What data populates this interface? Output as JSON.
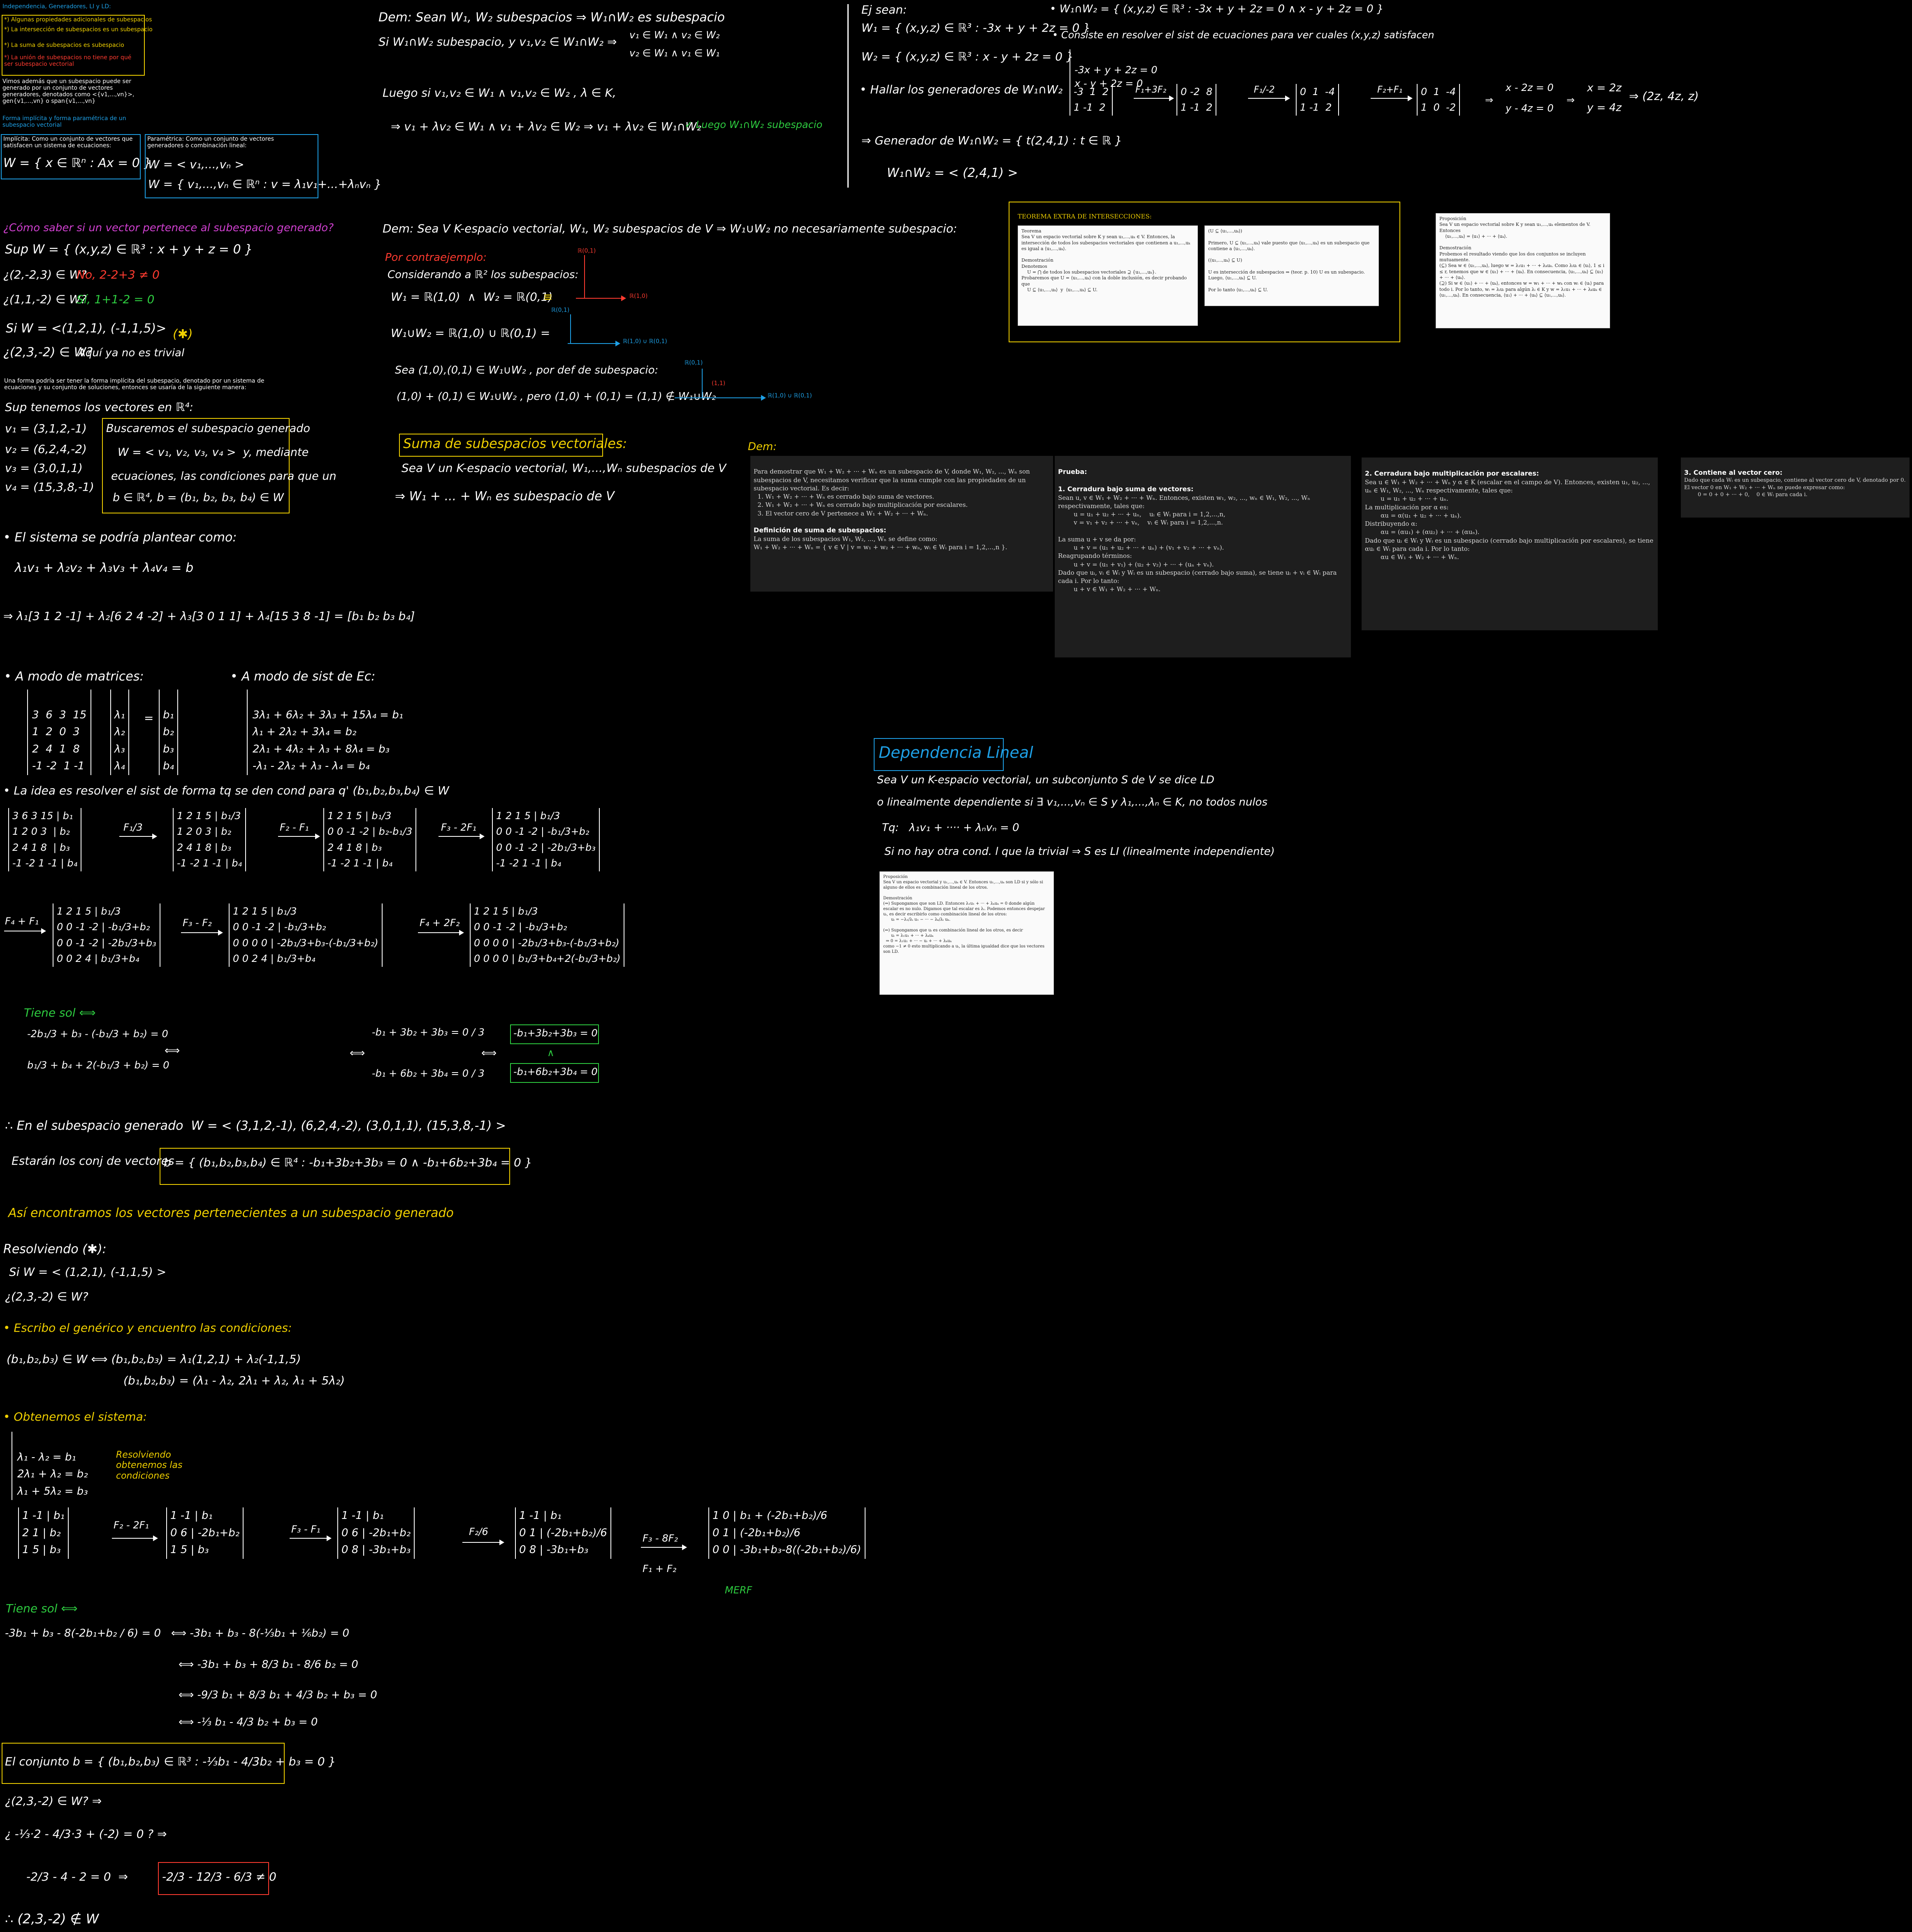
{
  "left": {
    "intro": {
      "title": "Independencia, Generadores, LI y LD:",
      "items": [
        "*) Algunas propiedades adicionales de subespacios",
        "*) La intersección de subespacios es un subespacio",
        "*) La suma de subespacios es subespacio",
        "*) La unión de subespacios no tiene por qué ser subespacio vectorial"
      ],
      "para": "Vimos además que un subespacio puede ser generado por un conjunto de vectores generadores, denotados como <{v1,...,vn}>, gen{v1,...,vn} o span{v1,...,vn}",
      "forms_title": "Forma implícita y forma paramétrica de un subespacio vectorial",
      "implicit_label": "Implícita: Como un conjunto de vectores que satisfacen un sistema de ecuaciones:",
      "implicit_formula": "W = { x ∈ ℝⁿ : Ax = 0 }",
      "param_label": "Paramétrica: Como un conjunto de vectores generadores o combinación lineal:",
      "param_formula1": "W = < v₁,...,vₙ >",
      "param_formula2": "W = { v₁,...,vₙ ∈ ℝⁿ : v = λ₁v₁+...+λₙvₙ }"
    },
    "q1": {
      "title": "¿Cómo saber si un vector pertenece al subespacio generado?",
      "l1": "Sup W = { (x,y,z) ∈ ℝ³ : x + y + z = 0 }",
      "l2": "¿(2,-2,3) ∈ W?",
      "l2b": "No, 2-2+3 ≠ 0",
      "l3": "¿(1,1,-2) ∈ W?",
      "l3b": "Sí, 1+1-2 = 0",
      "l4": "Si W = <(1,2,1), (-1,1,5)>",
      "l4b": "(✱)",
      "l5": "¿(2,3,-2) ∈ W?",
      "l5b": "Aquí ya no es trivial",
      "para2": "Una forma podría ser tener la forma implícita del subespacio, denotado por un sistema de ecuaciones y su conjunto de soluciones, entonces se usaría de la siguiente manera:",
      "sup": "Sup tenemos los vectores en ℝ⁴:",
      "v1": "v₁ = (3,1,2,-1)",
      "v2": "v₂ = (6,2,4,-2)",
      "v3": "v₃ = (3,0,1,1)",
      "v4": "v₄ = (15,3,8,-1)",
      "box1": "Buscaremos el subespacio generado",
      "box2": "W = < v₁, v₂, v₃, v₄ >  y, mediante",
      "box3": "ecuaciones, las condiciones para que un",
      "box4": "b ∈ ℝ⁴, b = (b₁, b₂, b₃, b₄) ∈ W",
      "el": "• El sistema se podría plantear como:",
      "eq": "λ₁v₁ + λ₂v₂ + λ₃v₃ + λ₄v₄ = b",
      "eqv": "⇒ λ₁[3 1 2 -1] + λ₂[6 2 4 -2] + λ₃[3 0 1 1] + λ₄[15 3 8 -1] = [b₁ b₂ b₃ b₄]"
    },
    "matrices": {
      "mode1": "• A modo de matrices:",
      "mode2": "• A modo de sist de Ec:",
      "m_rows": [
        "3  6  3  15",
        "1  2  0  3",
        "2  4  1  8",
        "-1 -2  1 -1"
      ],
      "lam": [
        "λ₁",
        "λ₂",
        "λ₃",
        "λ₄"
      ],
      "bs": [
        "b₁",
        "b₂",
        "b₃",
        "b₄"
      ],
      "sys": [
        "3λ₁ + 6λ₂ + 3λ₃ + 15λ₄ = b₁",
        "λ₁ + 2λ₂ + 3λ₄ = b₂",
        "2λ₁ + 4λ₂ + λ₃ + 8λ₄ = b₃",
        "-λ₁ - 2λ₂ + λ₃ - λ₄ = b₄"
      ]
    },
    "idea": {
      "title": "• La idea es resolver el sist de forma tq se den cond para q' (b₁,b₂,b₃,b₄) ∈ W",
      "ops": [
        "F₁/3",
        "F₂ - F₁",
        "F₃ - 2F₁",
        "F₄ + F₁",
        "F₃ - F₂",
        "F₄ + 2F₂"
      ],
      "tiene": "Tiene sol ⟺",
      "c1": "-2b₁/3 + b₃ - (-b₁/3 + b₂) = 0",
      "c2": "b₁/3 + b₄ + 2(-b₁/3 + b₂) = 0",
      "c3": "-b₁ + 3b₂ + 3b₃ = 0 / 3",
      "c4": "-b₁ + 6b₂ + 3b₄ = 0 / 3",
      "r1": "-b₁+3b₂+3b₃ = 0",
      "r2": "-b₁+6b₂+3b₄ = 0",
      "conclusion": "∴ En el subespacio generado  W = < (3,1,2,-1), (6,2,4,-2), (3,0,1,1), (15,3,8,-1) >",
      "estaran": "Estarán los conj de vectores",
      "set": "b = { (b₁,b₂,b₃,b₄) ∈ ℝ⁴ : -b₁+3b₂+3b₃ = 0 ∧ -b₁+6b₂+3b₄ = 0 }",
      "asi": "Así encontramos los vectores pertenecientes a un subespacio generado"
    },
    "resolv": {
      "title": "Resolviendo (✱):",
      "l1": "Si W = < (1,2,1), (-1,1,5) >",
      "l2": "¿(2,3,-2) ∈ W?",
      "escribo": "• Escribo el genérico y encuentro las condiciones:",
      "g1": "(b₁,b₂,b₃) ∈ W ⟺ (b₁,b₂,b₃) = λ₁(1,2,1) + λ₂(-1,1,5)",
      "g2": "(b₁,b₂,b₃) = (λ₁ - λ₂, 2λ₁ + λ₂, λ₁ + 5λ₂)",
      "obt": "• Obtenemos el sistema:",
      "s": [
        "λ₁ - λ₂ = b₁",
        "2λ₁ + λ₂ = b₂",
        "λ₁ + 5λ₂ = b₃"
      ],
      "note": "Resolviendo obtenemos las condiciones",
      "ops": [
        "F₂ - 2F₁",
        "F₃ - F₁",
        "F₂/6",
        "F₃ - 8F₂",
        "F₁ + F₂"
      ],
      "merf": "MERF",
      "tiene": "Tiene sol ⟺",
      "e1": "-3b₁ + b₃ - 8(-2b₁+b₂ / 6) = 0   ⟺ -3b₁ + b₃ - 8(-⅓b₁ + ⅙b₂) = 0",
      "e2": "⟺ -3b₁ + b₃ + 8/3 b₁ - 8/6 b₂ = 0",
      "e3": "⟺ -9/3 b₁ + 8/3 b₁ + 4/3 b₂ + b₃ = 0",
      "e4": "⟺ -⅓ b₁ - 4/3 b₂ + b₃ = 0",
      "conj": "El conjunto b = { (b₁,b₂,b₃) ∈ ℝ³ : -⅓b₁ - 4/3b₂ + b₃ = 0 }",
      "q": "¿(2,3,-2) ∈ W? ⇒",
      "q2": "¿ -⅓·2 - 4/3·3 + (-2) = 0 ? ⇒",
      "q3": "-2/3 - 4 - 2 = 0  ⇒",
      "q3b": "-2/3 - 12/3 - 6/3 ≠ 0",
      "final": "∴ (2,3,-2) ∉ W"
    }
  },
  "mid": {
    "dem1": {
      "l1": "Dem: Sean W₁, W₂ subespacios ⇒ W₁∩W₂ es subespacio",
      "l2": "Si W₁∩W₂ subespacio, y v₁,v₂ ∈ W₁∩W₂ ⇒",
      "l2r1": "v₁ ∈ W₁ ∧ v₂ ∈ W₂",
      "l2r2": "v₂ ∈ W₁ ∧ v₁ ∈ W₁",
      "l3": "Luego si v₁,v₂ ∈ W₁ ∧ v₁,v₂ ∈ W₂ , λ ∈ K,",
      "l4": "⇒ v₁ + λv₂ ∈ W₁ ∧ v₁ + λv₂ ∈ W₂ ⇒ v₁ + λv₂ ∈ W₁∩W₂",
      "l4g": "✓ Luego W₁∩W₂ subespacio"
    },
    "dem2": {
      "l1": "Dem: Sea V K-espacio vectorial, W₁, W₂ subespacios de V ⇒ W₁∪W₂ no necesariamente subespacio:",
      "contra": "Por contraejemplo:",
      "l2": "Considerando a ℝ² los subespacios:",
      "l3": "W₁ = ℝ(1,0)  ∧  W₂ = ℝ(0,1)",
      "l4": "W₁∪W₂ = ℝ(1,0) ∪ ℝ(0,1) =",
      "l5": "Sea (1,0),(0,1) ∈ W₁∪W₂ , por def de subespacio:",
      "l6": "(1,0) + (0,1) ∈ W₁∪W₂ , pero (1,0) + (0,1) = (1,1) ∉ W₁∪W₂",
      "lab_r01": "ℝ(0,1)",
      "lab_r10": "ℝ(1,0)",
      "lab_u": "ℝ(1,0) ∪ ℝ(0,1)",
      "lab_pt": "(1,1)"
    },
    "suma": {
      "title": "Suma de subespacios vectoriales:",
      "l1": "Sea V un K-espacio vectorial, W₁,...,Wₙ subespacios de V",
      "l2": "⇒ W₁ + ... + Wₙ es subespacio de V"
    },
    "ej": {
      "title": "Ej sean:",
      "w1": "W₁ = { (x,y,z) ∈ ℝ³ : -3x + y + 2z = 0 }",
      "w2": "W₂ = { (x,y,z) ∈ ℝ³ : x - y + 2z = 0 }",
      "hallar": "• Hallar los generadores de W₁∩W₂",
      "int": "• W₁∩W₂ = { (x,y,z) ∈ ℝ³ : -3x + y + 2z = 0 ∧ x - y + 2z = 0 }",
      "consiste": "• Consiste en resolver el sist de ecuaciones para ver cuales (x,y,z) satisfacen",
      "s1": "-3x + y + 2z = 0",
      "s2": "x - y + 2z = 0",
      "ops": [
        "F₁+3F₂",
        "F₁/-2",
        "F₂+F₁"
      ],
      "res1": "x - 2z = 0",
      "res2": "y - 4z = 0",
      "x": "x = 2z",
      "y": "y = 4z",
      "vec": "⇒ (2z, 4z, z)",
      "gen": "⇒ Generador de W₁∩W₂ = { t(2,4,1) : t ∈ ℝ }",
      "gen2": "W₁∩W₂ = < (2,4,1) >"
    },
    "teorema_title": "TEOREMA EXTRA DE INTERSECCIONES:",
    "teo_a": "Teorema\nSea V un espacio vectorial sobre K y sean u₁,...,uₖ ∈ V. Entonces, la intersección de todos los subespacios vectoriales que contienen a u₁,...,uₖ es igual a ⟨u₁,...,uₖ⟩.\n\nDemostración\nDenotemos\n    U = ⋂ de todos los subespacios vectoriales ⊇ {u₁,...,uₖ}.\nProbaremos que U = ⟨u₁,...,uₖ⟩ con la doble inclusión, es decir probando que\n    U ⊆ ⟨u₁,...,uₖ⟩  y  ⟨u₁,...,uₖ⟩ ⊆ U.",
    "teo_b": "(U ⊆ ⟨u₁,...,uₖ⟩)\n\nPrimero, U ⊆ ⟨u₁,...,uₖ⟩ vale puesto que ⟨u₁,...,uₖ⟩ es un subespacio que contiene a ⟨u₁,...,uₖ⟩.\n\n(⟨u₁,...,uₖ⟩ ⊆ U)\n\nU es intersección de subespacios ⇒ (teor. p. 10) U es un subespacio. Luego, ⟨u₁,...,uₖ⟩ ⊆ U.\n\nPor lo tanto ⟨u₁,...,uₖ⟩ ⊆ U.",
    "prop": "Proposición\nSea V un espacio vectorial sobre K y sean u₁,...,uₖ elementos de V. Entonces\n    ⟨u₁,...,uₖ⟩ = ⟨u₁⟩ + ··· + ⟨uₖ⟩.\n\nDemostración\nProbemos el resultado viendo que los dos conjuntos se incluyen mutuamente.\n(⊆) Sea w ∈ ⟨u₁,...,uₖ⟩, luego w = λ₁u₁ + ··· + λₖuₖ. Como λᵢuᵢ ∈ ⟨uᵢ⟩, 1 ≤ i ≤ r, tenemos que w ∈ ⟨u₁⟩ + ··· + ⟨uₖ⟩. En consecuencia, ⟨u₁,...,uₖ⟩ ⊆ ⟨u₁⟩ + ··· + ⟨uₖ⟩.\n(⊇) Si w ∈ ⟨u₁⟩ + ··· + ⟨uₖ⟩, entonces w = w₁ + ··· + wₖ con wᵢ ∈ ⟨uᵢ⟩ para todo i. Por lo tanto, wᵢ = λᵢuᵢ para algún λᵢ ∈ K y w = λ₁u₁ + ··· + λₖuₖ ∈ ⟨u₁,...,uₖ⟩. En consecuencia, ⟨u₁⟩ + ··· + ⟨uₖ⟩ ⊆ ⟨u₁,...,uₖ⟩.",
    "dem_label": "Dem:",
    "p1_title": "",
    "p1": "Para demostrar que W₁ + W₂ + ··· + Wₙ es un subespacio de V, donde W₁, W₂, ..., Wₙ son subespacios de V, necesitamos verificar que la suma cumple con las propiedades de un subespacio vectorial. Es decir:\n  1. W₁ + W₂ + ··· + Wₙ es cerrado bajo suma de vectores.\n  2. W₁ + W₂ + ··· + Wₙ es cerrado bajo multiplicación por escalares.\n  3. El vector cero de V pertenece a W₁ + W₂ + ··· + Wₙ.",
    "p1_h2": "Definición de suma de subespacios:",
    "p1b": "La suma de los subespacios W₁, W₂, ..., Wₙ se define como:\nW₁ + W₂ + ··· + Wₙ = { v ∈ V | v = w₁ + w₂ + ··· + wₙ, wᵢ ∈ Wᵢ para i = 1,2,...,n }.",
    "p2_title": "Prueba:",
    "p2_h": "1. Cerradura bajo suma de vectores:",
    "p2": "Sean u, v ∈ W₁ + W₂ + ··· + Wₙ. Entonces, existen w₁, w₂, ..., wₙ ∈ W₁, W₂, ..., Wₙ respectivamente, tales que:\n        u = u₁ + u₂ + ··· + uₙ,    uᵢ ∈ Wᵢ para i = 1,2,...,n,\n        v = v₁ + v₂ + ··· + vₙ,    vᵢ ∈ Wᵢ para i = 1,2,...,n.\n\nLa suma u + v se da por:\n        u + v = (u₁ + u₂ + ··· + uₙ) + (v₁ + v₂ + ··· + vₙ).\nReagrupando términos:\n        u + v = (u₁ + v₁) + (u₂ + v₂) + ··· + (uₙ + vₙ).",
    "p2b": "Dado que uᵢ, vᵢ ∈ Wᵢ y Wᵢ es un subespacio (cerrado bajo suma), se tiene uᵢ + vᵢ ∈ Wᵢ para cada i. Por lo tanto:\n        u + v ∈ W₁ + W₂ + ··· + Wₙ.",
    "p3_h": "2. Cerradura bajo multiplicación por escalares:",
    "p3": "Sea u ∈ W₁ + W₂ + ··· + Wₙ y α ∈ K (escalar en el campo de V). Entonces, existen u₁, u₂, ..., uₙ ∈ W₁, W₂, ..., Wₙ respectivamente, tales que:\n        u = u₁ + u₂ + ··· + uₙ.\nLa multiplicación por α es:\n        αu = α(u₁ + u₂ + ··· + uₙ).\nDistribuyendo α:\n        αu = (αu₁) + (αu₂) + ··· + (αuₙ).\nDado que uᵢ ∈ Wᵢ y Wᵢ es un subespacio (cerrado bajo multiplicación por escalares), se tiene αuᵢ ∈ Wᵢ para cada i. Por lo tanto:\n        αu ∈ W₁ + W₂ + ··· + Wₙ.",
    "p4_h": "3. Contiene al vector cero:",
    "p4": "Dado que cada Wᵢ es un subespacio, contiene al vector cero de V, denotado por 0. El vector 0 en W₁ + W₂ + ··· + Wₙ se puede expresar como:\n        0 = 0 + 0 + ··· + 0,    0 ∈ Wᵢ para cada i.",
    "dep": {
      "title": "Dependencia Lineal",
      "l1": "Sea V un K-espacio vectorial, un subconjunto S de V se dice LD",
      "l2": "o linealmente dependiente si ∃ v₁,...,vₙ ∈ S y λ₁,...,λₙ ∈ K, no todos nulos",
      "l3": "Tq:   λ₁v₁ + ···· + λₙvₙ = 0",
      "l4": "Si no hay otra cond. l que la trivial ⇒ S es LI (linealmente independiente)",
      "prop": "Proposición\nSea V un espacio vectorial y u₁,...,uₖ ∈ V. Entonces u₁,...,uₖ son LD si y sólo si alguno de ellos es combinación lineal de los otros.\n\nDemostración\n(⇒) Supongamos que son LD. Entonces λ₁u₁ + ··· + λₖuₖ = 0 donde algún escalar es no nulo. Digamos que tal escalar es λᵢ. Podemos entonces despejar uᵢ, es decir escribirlo como combinación lineal de los otros:\n      uᵢ = −λ₁/λᵢ u₁ − ··· − λₖ/λᵢ uₖ.\n\n(⇐) Supongamos que uᵢ es combinación lineal de los otros, es decir\n      uᵢ = λ₁u₁ + ··· + λₖuₖ\n  ⇒ 0 = λ₁u₁ + ··· − uᵢ + ··· + λₖuₖ\ncomo −1 ≠ 0 esto multiplicando a uᵢ, la última igualdad dice que los vectores son LD."
    }
  },
  "colors": {
    "bg": "#000000",
    "text": "#ffffff",
    "yellow": "#f0d000",
    "green": "#2ecc40",
    "red": "#ff3b30",
    "cyan": "#1ea0e6",
    "magenta": "#d040d0"
  }
}
